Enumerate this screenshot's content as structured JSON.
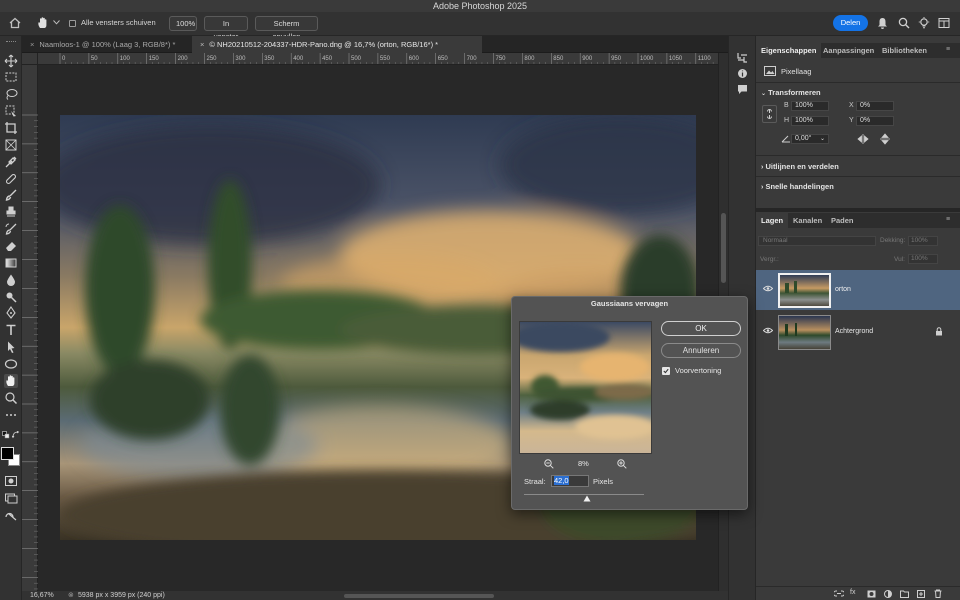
{
  "app": {
    "title": "Adobe Photoshop 2025"
  },
  "options_bar": {
    "scroll_all_label": "Alle vensters schuiven",
    "zoom_100_label": "100%",
    "fit_window_label": "In venster",
    "fill_screen_label": "Scherm opvullen",
    "share_label": "Delen"
  },
  "doc_tabs": [
    {
      "label": "Naamloos-1 @ 100% (Laag 3, RGB/8*) *",
      "active": false
    },
    {
      "label": "© NH20210512-204337-HDR-Pano.dng @ 16,7% (orton, RGB/16*) *",
      "active": true
    }
  ],
  "ruler_labels": [
    "0",
    "50",
    "100",
    "150",
    "200",
    "250",
    "300",
    "350",
    "400",
    "450",
    "500",
    "550",
    "600",
    "650",
    "700",
    "750",
    "800",
    "850",
    "900",
    "950",
    "1000",
    "1050",
    "1100"
  ],
  "status": {
    "zoom": "16,67%",
    "doc_info": "5938 px x 3959 px (240 ppi)"
  },
  "properties": {
    "tabs": [
      "Eigenschappen",
      "Aanpassingen",
      "Bibliotheken"
    ],
    "layer_type": "Pixellaag",
    "transform_title": "Transformeren",
    "b_label": "B",
    "b_value": "100%",
    "h_label": "H",
    "h_value": "100%",
    "x_label": "X",
    "x_value": "0%",
    "y_label": "Y",
    "y_value": "0%",
    "angle_value": "0,00°",
    "align_title": "Uitlijnen en verdelen",
    "quick_title": "Snelle handelingen"
  },
  "layers": {
    "tabs": [
      "Lagen",
      "Kanalen",
      "Paden"
    ],
    "filter_label": "Vergr.:",
    "blend_mode": "Normaal",
    "opacity_label": "Dekking:",
    "opacity_value": "100%",
    "fill_label": "Vul:",
    "fill_value": "100%",
    "items": [
      {
        "name": "orton",
        "selected": true,
        "locked": false
      },
      {
        "name": "Achtergrond",
        "selected": false,
        "locked": true
      }
    ]
  },
  "dialog": {
    "title": "Gaussiaans vervagen",
    "ok_label": "OK",
    "cancel_label": "Annuleren",
    "preview_label": "Voorvertoning",
    "preview_checked": true,
    "zoom_value": "8%",
    "radius_label": "Straal:",
    "radius_value": "42,0",
    "radius_unit": "Pixels"
  },
  "colors": {
    "accent": "#1473e6",
    "selected_layer": "#4f6580"
  }
}
